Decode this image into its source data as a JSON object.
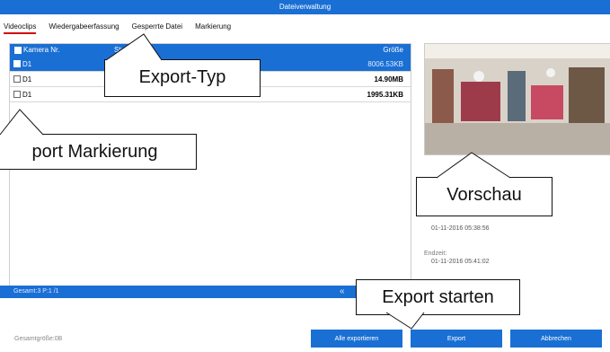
{
  "window": {
    "title": "Dateiverwaltung"
  },
  "tabs": [
    {
      "label": "Videoclips",
      "active": true
    },
    {
      "label": "Wiedergabeerfassung",
      "active": false
    },
    {
      "label": "Gesperrte Datei",
      "active": false
    },
    {
      "label": "Markierung",
      "active": false
    }
  ],
  "list": {
    "headers": {
      "camera": "Kamera Nr.",
      "start": "Start-/",
      "size": "Größe"
    },
    "rows": [
      {
        "camera": "D1",
        "size": "8006.53KB",
        "selected": true
      },
      {
        "camera": "D1",
        "size": "14.90MB",
        "selected": false
      },
      {
        "camera": "D1",
        "size": "1995.31KB",
        "selected": false
      }
    ],
    "footer": {
      "count": "Gesamt:3 P:1 /1",
      "nav": "«"
    }
  },
  "preview": {
    "start_label": "",
    "start_time": "01-11-2016 05:38:56",
    "end_label": "Endzeit:",
    "end_time": "01-11-2016 05:41:02"
  },
  "bottom": {
    "total": "Gesamtgröße:0B",
    "buttons": {
      "export_all": "Alle exportieren",
      "export": "Export",
      "cancel": "Abbrechen"
    }
  },
  "callouts": {
    "export_type": "Export-Typ",
    "export_marking": "port Markierung",
    "preview": "Vorschau",
    "export_start": "Export starten"
  },
  "colors": {
    "accent": "#1a6fd4",
    "active_tab_underline": "#d01010"
  }
}
